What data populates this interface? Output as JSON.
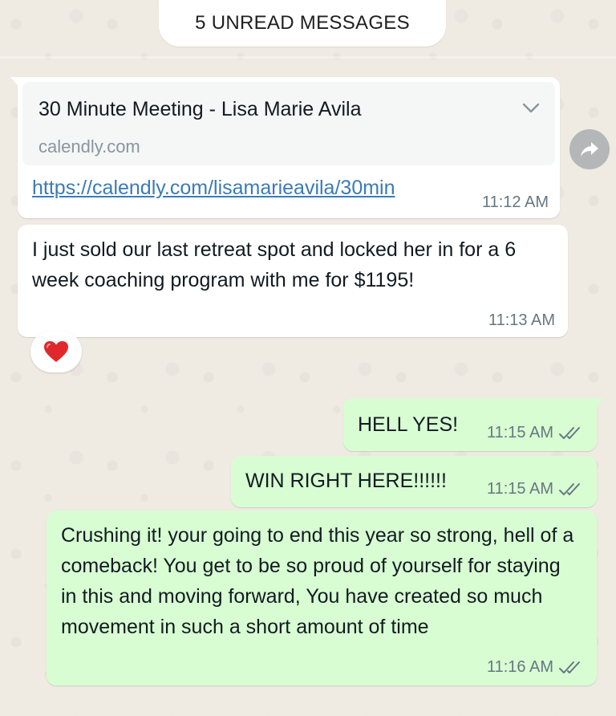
{
  "unread_banner": {
    "label": "5 UNREAD MESSAGES"
  },
  "messages": [
    {
      "direction": "incoming",
      "type": "link",
      "preview_title": "30 Minute Meeting - Lisa Marie Avila",
      "preview_domain": "calendly.com",
      "url": "https://calendly.com/lisamarieavila/30min",
      "time": "11:12 AM"
    },
    {
      "direction": "incoming",
      "type": "text",
      "text": "I just sold our last retreat spot and locked her in for a 6 week coaching program with me for $1195!",
      "time": "11:13 AM",
      "reaction": "❤️"
    },
    {
      "direction": "outgoing",
      "type": "text",
      "text": "HELL YES!",
      "time": "11:15 AM",
      "status": "read"
    },
    {
      "direction": "outgoing",
      "type": "text",
      "text": "WIN RIGHT HERE!!!!!!",
      "time": "11:15 AM",
      "status": "read"
    },
    {
      "direction": "outgoing",
      "type": "text",
      "text": "Crushing it! your going to end this year so strong, hell of a comeback! You get to be so proud of yourself for staying in this and moving forward, You have created so much movement in such a short amount of time",
      "time": "11:16 AM",
      "status": "read"
    }
  ],
  "icons": {
    "forward": "forward-arrow-icon",
    "chevron": "chevron-down-icon",
    "read_ticks": "double-check-icon",
    "reaction": "heart-icon"
  },
  "colors": {
    "chat_background": "#efeae2",
    "incoming_bubble": "#ffffff",
    "outgoing_bubble": "#d9fdd3",
    "link": "#3a7bb8",
    "timestamp": "#667781"
  }
}
